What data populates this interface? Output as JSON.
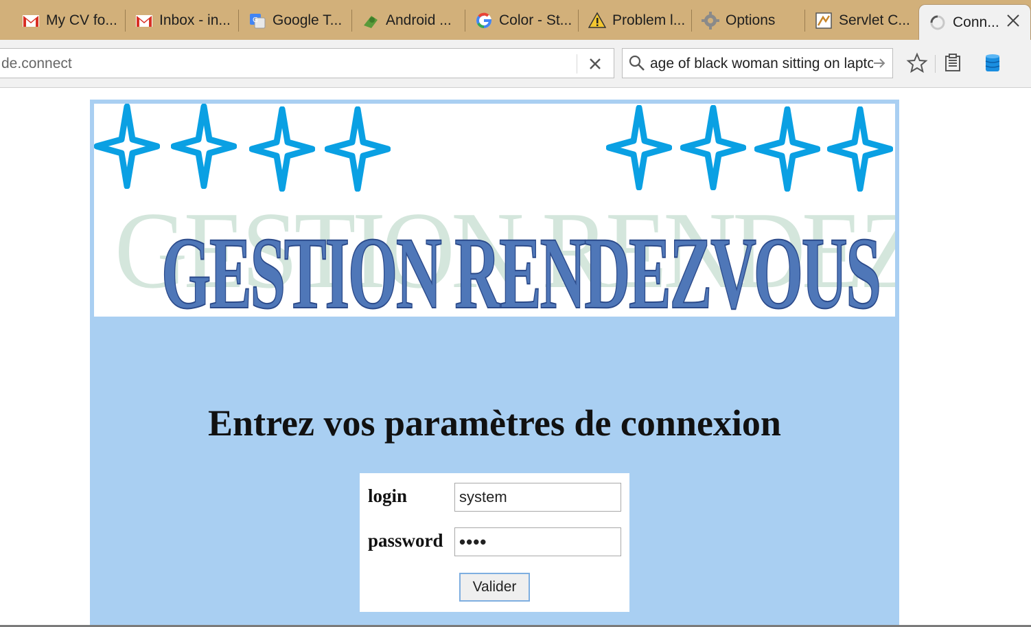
{
  "browser": {
    "tabs": [
      {
        "title": "My CV fo...",
        "icon": "gmail-icon"
      },
      {
        "title": "Inbox - in...",
        "icon": "gmail-icon"
      },
      {
        "title": "Google T...",
        "icon": "google-translate-icon"
      },
      {
        "title": "Android ...",
        "icon": "android-icon"
      },
      {
        "title": "Color - St...",
        "icon": "google-g-icon"
      },
      {
        "title": "Problem l...",
        "icon": "warning-icon"
      },
      {
        "title": "Options",
        "icon": "gear-icon"
      },
      {
        "title": "Servlet C...",
        "icon": "servlet-icon"
      },
      {
        "title": "Conn...",
        "icon": "loading-icon",
        "active": true
      }
    ],
    "address": "de.connect",
    "search_text": "age of black woman sitting on laptop"
  },
  "colors": {
    "tabstrip": "#d2b07a",
    "page_bg": "#a9cff2",
    "star": "#0aa0e3",
    "wordart": "#4f77b8",
    "watermark": "#d4e6dc"
  },
  "banner": {
    "watermark_text": "GESTION RENDEZVOUS",
    "title": "GESTION RENDEZVOUS"
  },
  "login": {
    "heading": "Entrez vos paramètres de connexion",
    "login_label": "login",
    "login_value": "system",
    "password_label": "password",
    "password_value": "••••",
    "submit_label": "Valider"
  }
}
